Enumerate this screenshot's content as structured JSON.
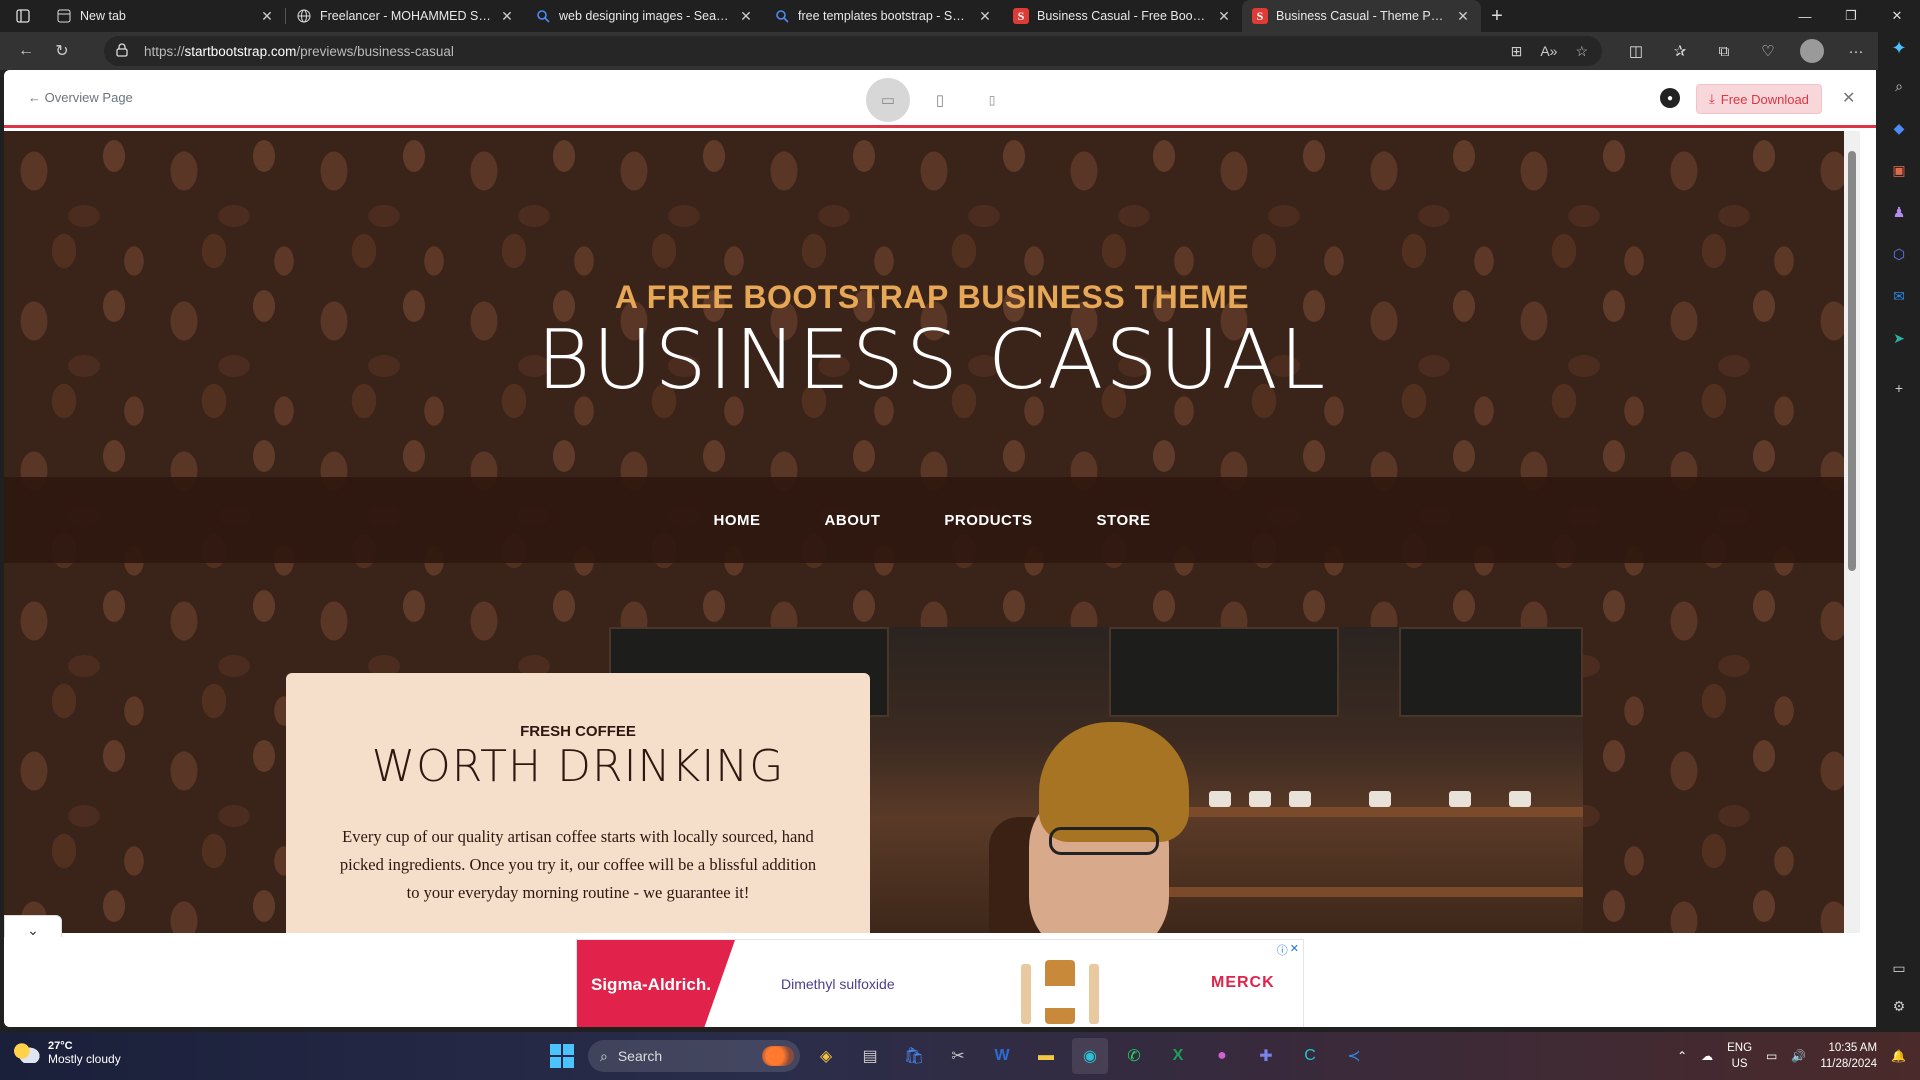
{
  "browser": {
    "tabs": [
      {
        "title": "New tab",
        "favicon": "newtab-icon"
      },
      {
        "title": "Freelancer - MOHAMMED SUHA",
        "favicon": "globe-icon"
      },
      {
        "title": "web designing images - Search",
        "favicon": "search-icon"
      },
      {
        "title": "free templates bootstrap - Search",
        "favicon": "search-icon"
      },
      {
        "title": "Business Casual - Free Bootstrap",
        "favicon": "startbootstrap-icon"
      },
      {
        "title": "Business Casual - Theme Preview",
        "favicon": "startbootstrap-icon",
        "active": true
      }
    ],
    "url_prefix": "https://",
    "url_host": "startbootstrap.com",
    "url_path": "/previews/business-casual"
  },
  "preview_bar": {
    "back_label": "Overview Page",
    "download_label": "Free Download",
    "devices": [
      "desktop",
      "tablet",
      "mobile"
    ],
    "active_device": "desktop"
  },
  "site": {
    "heading_upper": "A FREE BOOTSTRAP BUSINESS THEME",
    "heading_lower": "BUSINESS CASUAL",
    "nav": [
      "HOME",
      "ABOUT",
      "PRODUCTS",
      "STORE"
    ],
    "intro": {
      "upper": "FRESH COFFEE",
      "lower": "WORTH DRINKING",
      "body": "Every cup of our quality artisan coffee starts with locally sourced, hand picked ingredients. Once you try it, our coffee will be a blissful addition to your everyday morning routine - we guarantee it!"
    },
    "colors": {
      "accent": "#e6a756",
      "nav_bg": "#2f170f",
      "intro_bg": "#f5deca"
    }
  },
  "ad": {
    "brand": "Sigma-Aldrich.",
    "product": "Dimethyl sulfoxide",
    "logo": "MERCK"
  },
  "taskbar": {
    "weather_temp": "27°C",
    "weather_desc": "Mostly cloudy",
    "search_label": "Search",
    "lang_line1": "ENG",
    "lang_line2": "US",
    "time": "10:35 AM",
    "date": "11/28/2024"
  }
}
